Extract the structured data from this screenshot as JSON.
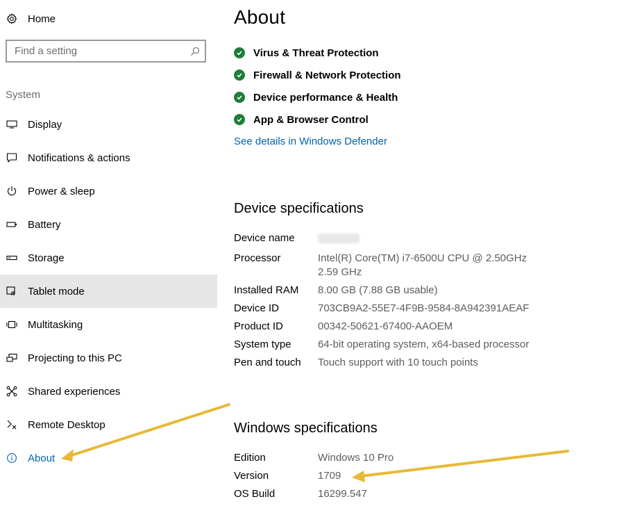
{
  "sidebar": {
    "home_label": "Home",
    "search_placeholder": "Find a setting",
    "section_label": "System",
    "items": [
      {
        "label": "Display",
        "icon": "monitor-icon"
      },
      {
        "label": "Notifications & actions",
        "icon": "speech-bubble-icon"
      },
      {
        "label": "Power & sleep",
        "icon": "power-icon"
      },
      {
        "label": "Battery",
        "icon": "battery-icon"
      },
      {
        "label": "Storage",
        "icon": "storage-icon"
      },
      {
        "label": "Tablet mode",
        "icon": "tablet-mode-icon"
      },
      {
        "label": "Multitasking",
        "icon": "multitasking-icon"
      },
      {
        "label": "Projecting to this PC",
        "icon": "projecting-icon"
      },
      {
        "label": "Shared experiences",
        "icon": "shared-experiences-icon"
      },
      {
        "label": "Remote Desktop",
        "icon": "remote-desktop-icon"
      },
      {
        "label": "About",
        "icon": "info-icon"
      }
    ]
  },
  "main": {
    "title": "About",
    "protections": [
      "Virus & Threat Protection",
      "Firewall & Network Protection",
      "Device performance & Health",
      "App & Browser Control"
    ],
    "defender_link": "See details in Windows Defender",
    "device_specs": {
      "heading": "Device specifications",
      "rows": [
        {
          "key": "Device name",
          "value": ""
        },
        {
          "key": "Processor",
          "value": "Intel(R) Core(TM) i7-6500U CPU @ 2.50GHz   2.59 GHz"
        },
        {
          "key": "Installed RAM",
          "value": "8.00 GB (7.88 GB usable)"
        },
        {
          "key": "Device ID",
          "value": "703CB9A2-55E7-4F9B-9584-8A942391AEAF"
        },
        {
          "key": "Product ID",
          "value": "00342-50621-67400-AAOEM"
        },
        {
          "key": "System type",
          "value": "64-bit operating system, x64-based processor"
        },
        {
          "key": "Pen and touch",
          "value": "Touch support with 10 touch points"
        }
      ]
    },
    "windows_specs": {
      "heading": "Windows specifications",
      "rows": [
        {
          "key": "Edition",
          "value": "Windows 10 Pro"
        },
        {
          "key": "Version",
          "value": "1709"
        },
        {
          "key": "OS Build",
          "value": "16299.547"
        }
      ]
    }
  },
  "colors": {
    "accent": "#0063b1",
    "check_green": "#1e7d3a",
    "annotation_arrow": "#e8b936",
    "active_bg": "#e6e6e6"
  }
}
